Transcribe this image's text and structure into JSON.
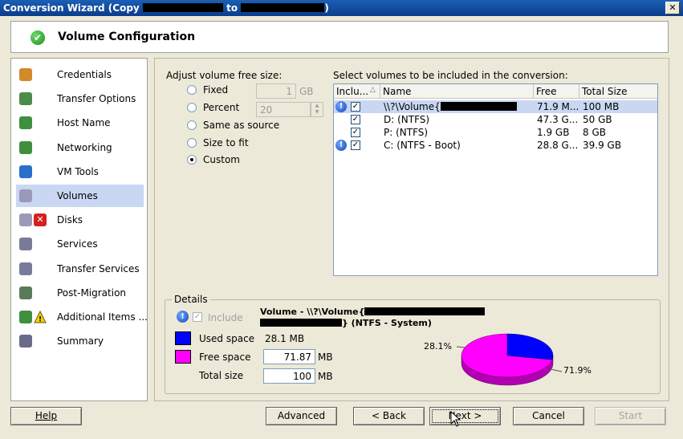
{
  "window": {
    "title_prefix": "Conversion Wizard (Copy",
    "title_middle": "to",
    "title_suffix": ")",
    "close_glyph": "✕"
  },
  "header": {
    "title": "Volume Configuration",
    "status_icon": "green-check-icon",
    "check_glyph": "✔"
  },
  "sidebar": {
    "items": [
      {
        "label": "Credentials",
        "icon": "credentials-icon",
        "color": "#d08a2a"
      },
      {
        "label": "Transfer Options",
        "icon": "transfer-options-icon",
        "color": "#4a8c4a"
      },
      {
        "label": "Host Name",
        "icon": "host-name-icon",
        "color": "#3f8f3f"
      },
      {
        "label": "Networking",
        "icon": "networking-icon",
        "color": "#3f8f3f"
      },
      {
        "label": "VM Tools",
        "icon": "vm-tools-icon",
        "color": "#2a6fc9"
      },
      {
        "label": "Volumes",
        "icon": "volumes-icon",
        "color": "#9a9ab8",
        "selected": true
      },
      {
        "label": "Disks",
        "icon": "disks-icon",
        "color": "#9a9ab8",
        "warning_icon": "error-x-icon"
      },
      {
        "label": "Services",
        "icon": "services-icon",
        "color": "#7a7a9a"
      },
      {
        "label": "Transfer Services",
        "icon": "transfer-services-icon",
        "color": "#7a7a9a"
      },
      {
        "label": "Post-Migration",
        "icon": "post-migration-icon",
        "color": "#5a7a5a"
      },
      {
        "label": "Additional Items ...",
        "icon": "additional-items-icon",
        "color": "#3f8f3f",
        "warning_icon": "warning-triangle-icon"
      },
      {
        "label": "Summary",
        "icon": "summary-icon",
        "color": "#6a6a8a"
      }
    ]
  },
  "free_size": {
    "heading": "Adjust volume free size:",
    "options": [
      {
        "label": "Fixed",
        "selected": false
      },
      {
        "label": "Percent",
        "selected": false
      },
      {
        "label": "Same as source",
        "selected": false
      },
      {
        "label": "Size to fit",
        "selected": false
      },
      {
        "label": "Custom",
        "selected": true
      }
    ],
    "fixed_value": "1",
    "fixed_unit": "GB",
    "percent_value": "20",
    "percent_unit": "%",
    "spin_up_glyph": "▲",
    "spin_down_glyph": "▼"
  },
  "volumes": {
    "heading": "Select volumes to be included in the conversion:",
    "columns": [
      "Inclu...",
      "Name",
      "Free",
      "Total Size"
    ],
    "sort_glyph": "△",
    "rows": [
      {
        "info": true,
        "checked": true,
        "name": "\\\\?\\Volume{",
        "free": "71.9 M...",
        "total": "100 MB",
        "selected": true
      },
      {
        "info": false,
        "checked": true,
        "name": "D: (NTFS)",
        "free": "47.3 G...",
        "total": "50 GB",
        "selected": false
      },
      {
        "info": false,
        "checked": true,
        "name": "P: (NTFS)",
        "free": "1.9 GB",
        "total": "8 GB",
        "selected": false
      },
      {
        "info": true,
        "checked": true,
        "name": "C: (NTFS - Boot)",
        "free": "28.8 G...",
        "total": "39.9 GB",
        "selected": false
      }
    ],
    "check_glyph": "✓",
    "info_glyph": "!"
  },
  "details": {
    "legend": "Details",
    "include_label": "Include",
    "volume_title_line1": "Volume - \\\\?\\Volume{",
    "volume_title_line2": "} (NTFS - System)",
    "used_label": "Used space",
    "used_value": "28.1 MB",
    "free_label": "Free space",
    "free_value": "71.87",
    "free_unit": "MB",
    "total_label": "Total size",
    "total_value": "100",
    "total_unit": "MB",
    "colors": {
      "used": "#0000ff",
      "free": "#ff00ff"
    },
    "pie_used_pct": 28.1,
    "pie_free_pct": 71.9,
    "pie_used_label": "28.1%",
    "pie_free_label": "71.9%"
  },
  "buttons": {
    "help": "Help",
    "advanced": "Advanced",
    "back": "< Back",
    "next": "Next >",
    "cancel": "Cancel",
    "start": "Start"
  }
}
